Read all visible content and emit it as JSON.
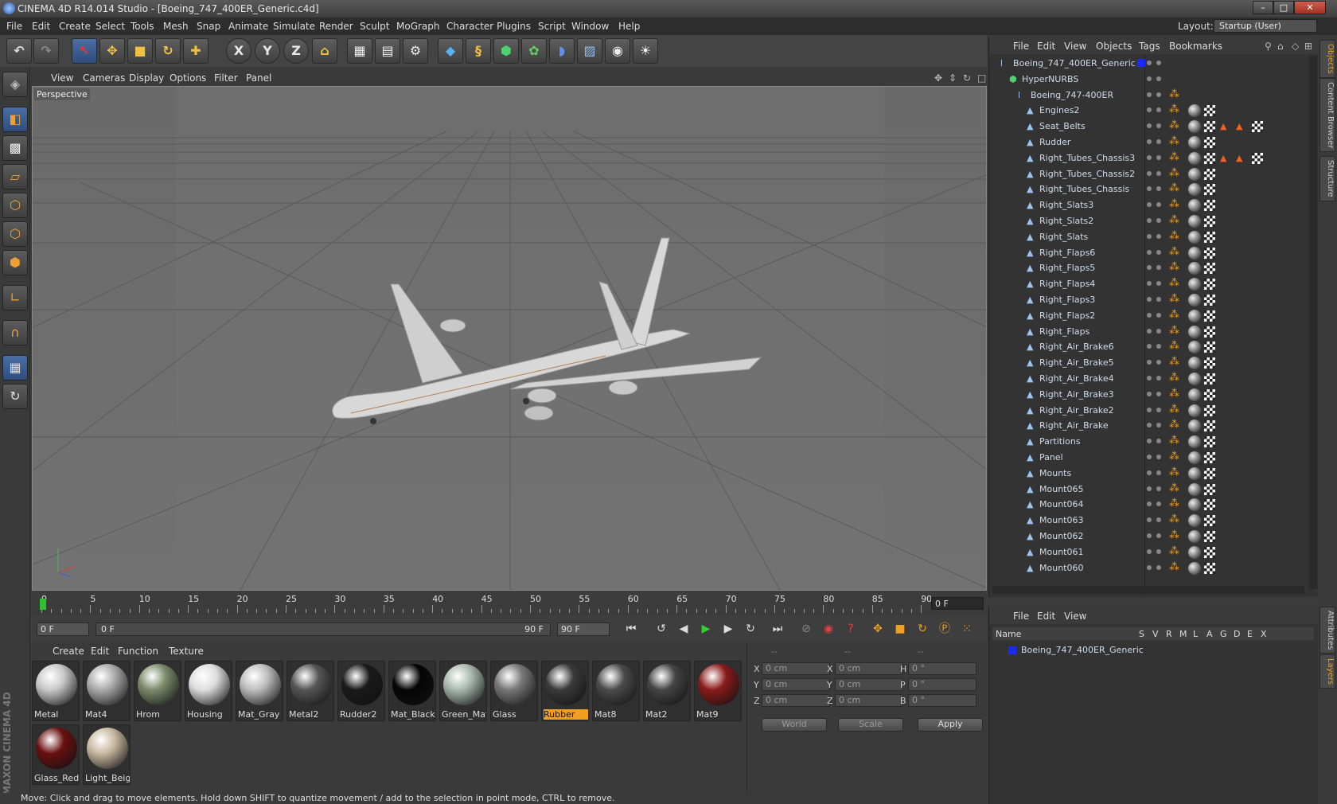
{
  "window": {
    "title": "CINEMA 4D R14.014 Studio - [Boeing_747_400ER_Generic.c4d]",
    "min": "–",
    "max": "□",
    "close": "✕"
  },
  "menu": [
    "File",
    "Edit",
    "Create",
    "Select",
    "Tools",
    "Mesh",
    "Snap",
    "Animate",
    "Simulate",
    "Render",
    "Sculpt",
    "MoGraph",
    "Character",
    "Plugins",
    "Script",
    "Window",
    "Help"
  ],
  "layout": {
    "label": "Layout:",
    "value": "Startup (User)"
  },
  "viewport": {
    "menu": [
      "View",
      "Cameras",
      "Display",
      "Options",
      "Filter",
      "Panel"
    ],
    "label": "Perspective"
  },
  "timeline": {
    "ticks": [
      "0",
      "5",
      "10",
      "15",
      "20",
      "25",
      "30",
      "35",
      "40",
      "45",
      "50",
      "55",
      "60",
      "65",
      "70",
      "75",
      "80",
      "85",
      "90"
    ],
    "current_frame": "0 F"
  },
  "transport": {
    "start": "0 F",
    "range_start": "0 F",
    "range_end": "90 F",
    "end": "90 F"
  },
  "materials": {
    "menu": [
      "Create",
      "Edit",
      "Function",
      "Texture"
    ],
    "items": [
      {
        "name": "Metal",
        "color": "#c8c8c8"
      },
      {
        "name": "Mat4",
        "color": "#aaaaaa"
      },
      {
        "name": "Hrom",
        "color": "#7a8a6a"
      },
      {
        "name": "Housing",
        "color": "#dddddd"
      },
      {
        "name": "Mat_Gray",
        "color": "#bdbdbd"
      },
      {
        "name": "Metal2",
        "color": "#555555"
      },
      {
        "name": "Rudder2",
        "color": "#1a1a1a"
      },
      {
        "name": "Mat_Black",
        "color": "#050505"
      },
      {
        "name": "Green_Mat",
        "color": "#a8b8b0"
      },
      {
        "name": "Glass",
        "color": "#777777"
      },
      {
        "name": "Rubber",
        "color": "#3a3a3a"
      },
      {
        "name": "Mat8",
        "color": "#4a4a4a"
      },
      {
        "name": "Mat2",
        "color": "#444444"
      },
      {
        "name": "Mat9",
        "color": "#8a1a1a"
      },
      {
        "name": "Glass_Red",
        "color": "#6a1010"
      },
      {
        "name": "Light_Beig",
        "color": "#c8b8a0"
      }
    ],
    "selected": "Rubber"
  },
  "coords": {
    "headers": [
      "--",
      "--",
      "--"
    ],
    "rows": [
      {
        "a": "X",
        "av": "0 cm",
        "b": "X",
        "bv": "0 cm",
        "c": "H",
        "cv": "0 °"
      },
      {
        "a": "Y",
        "av": "0 cm",
        "b": "Y",
        "bv": "0 cm",
        "c": "P",
        "cv": "0 °"
      },
      {
        "a": "Z",
        "av": "0 cm",
        "b": "Z",
        "bv": "0 cm",
        "c": "B",
        "cv": "0 °"
      }
    ],
    "world": "World",
    "scale": "Scale",
    "apply": "Apply"
  },
  "objects": {
    "menu": [
      "File",
      "Edit",
      "View",
      "Objects",
      "Tags",
      "Bookmarks"
    ],
    "rows": [
      {
        "name": "Boeing_747_400ER_Generic",
        "level": 0
      },
      {
        "name": "HyperNURBS",
        "level": 1
      },
      {
        "name": "Boeing_747-400ER",
        "level": 2
      },
      {
        "name": "Engines2",
        "level": 3
      },
      {
        "name": "Seat_Belts",
        "level": 3
      },
      {
        "name": "Rudder",
        "level": 3
      },
      {
        "name": "Right_Tubes_Chassis3",
        "level": 3
      },
      {
        "name": "Right_Tubes_Chassis2",
        "level": 3
      },
      {
        "name": "Right_Tubes_Chassis",
        "level": 3
      },
      {
        "name": "Right_Slats3",
        "level": 3
      },
      {
        "name": "Right_Slats2",
        "level": 3
      },
      {
        "name": "Right_Slats",
        "level": 3
      },
      {
        "name": "Right_Flaps6",
        "level": 3
      },
      {
        "name": "Right_Flaps5",
        "level": 3
      },
      {
        "name": "Right_Flaps4",
        "level": 3
      },
      {
        "name": "Right_Flaps3",
        "level": 3
      },
      {
        "name": "Right_Flaps2",
        "level": 3
      },
      {
        "name": "Right_Flaps",
        "level": 3
      },
      {
        "name": "Right_Air_Brake6",
        "level": 3
      },
      {
        "name": "Right_Air_Brake5",
        "level": 3
      },
      {
        "name": "Right_Air_Brake4",
        "level": 3
      },
      {
        "name": "Right_Air_Brake3",
        "level": 3
      },
      {
        "name": "Right_Air_Brake2",
        "level": 3
      },
      {
        "name": "Right_Air_Brake",
        "level": 3
      },
      {
        "name": "Partitions",
        "level": 3
      },
      {
        "name": "Panel",
        "level": 3
      },
      {
        "name": "Mounts",
        "level": 3
      },
      {
        "name": "Mount065",
        "level": 3
      },
      {
        "name": "Mount064",
        "level": 3
      },
      {
        "name": "Mount063",
        "level": 3
      },
      {
        "name": "Mount062",
        "level": 3
      },
      {
        "name": "Mount061",
        "level": 3
      },
      {
        "name": "Mount060",
        "level": 3
      }
    ]
  },
  "layers": {
    "menu": [
      "File",
      "Edit",
      "View"
    ],
    "header": {
      "name": "Name",
      "cols": [
        "S",
        "V",
        "R",
        "M",
        "L",
        "A",
        "G",
        "D",
        "E",
        "X"
      ]
    },
    "row": "Boeing_747_400ER_Generic"
  },
  "side_tabs": [
    "Objects",
    "Content Browser",
    "Structure",
    "Attributes",
    "Layers"
  ],
  "status": "Move: Click and drag to move elements. Hold down SHIFT to quantize movement / add to the selection in point mode, CTRL to remove.",
  "branding": "MAXON CINEMA 4D"
}
